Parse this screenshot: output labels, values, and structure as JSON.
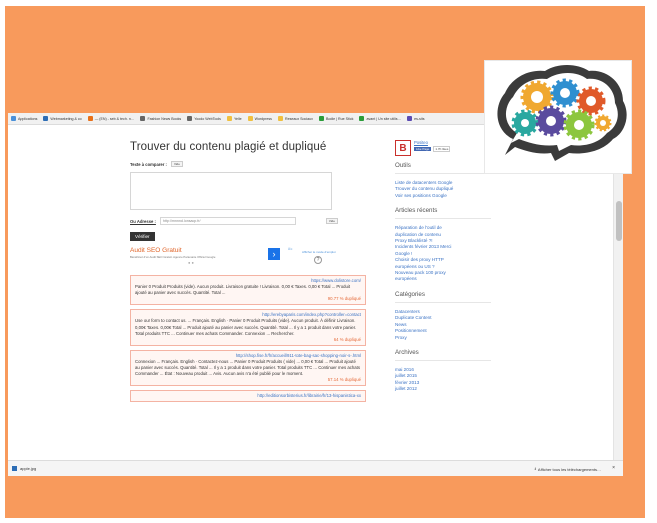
{
  "browser": {
    "top_strip": "",
    "bookmarks": [
      {
        "label": "Applications",
        "color": "#4a90d9"
      },
      {
        "label": "Webmarketing & co",
        "color": "#2d6db5"
      },
      {
        "label": "— (EN) - seb & tech. n…",
        "color": "#e8711a"
      },
      {
        "label": "Fashion News Books",
        "color": "#666666"
      },
      {
        "label": "Yoodo WebTools",
        "color": "#666666"
      },
      {
        "label": "Yelle",
        "color": "#f0c040"
      },
      {
        "label": "Wordpress",
        "color": "#f0c040"
      },
      {
        "label": "Reseaux Sociaux",
        "color": "#f0c040"
      },
      {
        "label": "Bodie | Rue Stick",
        "color": "#2a9d3a"
      },
      {
        "label": "avant | Un site utilis…",
        "color": "#2a9d3a"
      },
      {
        "label": "es-sits",
        "color": "#5b4bb3"
      }
    ],
    "download_file": "apple.jpg",
    "download_all": "Afficher tous les téléchargements…",
    "download_close": "×"
  },
  "main": {
    "title": "Trouver du contenu plagié et dupliqué",
    "text_label": "Texte à comparer :",
    "text_btn": "Vide",
    "addr_label": "Ou Adresse :",
    "addr_placeholder": "http://mnnnd.lonsacp.fr/",
    "addr_btn": "Vide",
    "verify_btn": "Vérifier"
  },
  "ad": {
    "title": "Audit SEO Gratuit",
    "subtitle": "Bénéficiez d'un Audit SEO Gratuit. Agence Partenaire Officiel Google",
    "close": "☒×",
    "link": "Afficher le mode d'emploi",
    "help": "?",
    "next": "›",
    "dots": "● ●"
  },
  "results": [
    {
      "url": "https://www.dolistore.com/",
      "text": "Panier 0 Produit Produits (vide). Aucun produit. Livraison gratuite ! Livraison. 0,00 € Taxes. 0,00 € Total ... Produit ajouté au panier avec succès. Quantité. Total ...",
      "pct": "90.77 % dupliqué"
    },
    {
      "url": "http://erebyaparis.com/index.php?controller=contact",
      "text": "Use our form to contact us. ... Français. English · Panier 0 Produit Produits (vide). Aucun produit. À définir Livraison. 0,00€ Taxes. 0,00€ Total ... Produit ajouté au panier avec succès. Quantité. Total ... Il y a 1 produit dans votre panier. Total produits TTC ... Continuer mes achats Commander. Connexion ... Rechercher.",
      "pct": "64 % dupliqué"
    },
    {
      "url": "http://shop.fise.fr/fr/accueil/911-tote-bag-sac-shopping-noir-s-.html",
      "text": "Connexion ... Français. English · Contactez-nous ... Panier 0 Produit Produits ( vide) ... 0,00 € Total ... Produit ajouté au panier avec succès. Quantité. Total ... Il y a 1 produit dans votre panier. Total produits TTC ... Continuer mes achats Commander ... État : Nouveau produit ... Avis. Aucun avis n'a été publié pour le moment.",
      "pct": "57.14 % dupliqué"
    },
    {
      "url": "http://editionsorbisterius.fr/librairie/fr/13-hispanistica-xx",
      "text": "",
      "pct": ""
    }
  ],
  "sidebar": {
    "brand_initial": "B",
    "brand_name": "Positeo",
    "like_label": "Like Page",
    "like_count": "1.7K likes",
    "tools_title": "Outils",
    "tools": [
      "Liste de datacenters Google",
      "Trouver du contenu dupliqué",
      "Voir ses positions Google"
    ],
    "recent_title": "Articles récents",
    "recent": [
      "Réparation de l'outil de",
      "duplication de contenu",
      "Proxy Blacklisté ?!",
      "Incidents février 2013 Merci",
      "Google !",
      "Choisir des proxy HTTP",
      "européens ou US ?",
      "Nouveau pack 100 proxy",
      "européens"
    ],
    "cat_title": "Catégories",
    "categories": [
      "Datacenters",
      "Duplicate Content",
      "News",
      "Positionnement",
      "Proxy"
    ],
    "arch_title": "Archives",
    "archives": [
      "mai 2016",
      "juillet 2015",
      "février 2013",
      "juillet 2012"
    ]
  },
  "colors": {
    "frame": "#f89a5c",
    "accent_orange": "#e56b3a",
    "link_blue": "#3a72c4",
    "result_border": "#f4b3a3"
  }
}
